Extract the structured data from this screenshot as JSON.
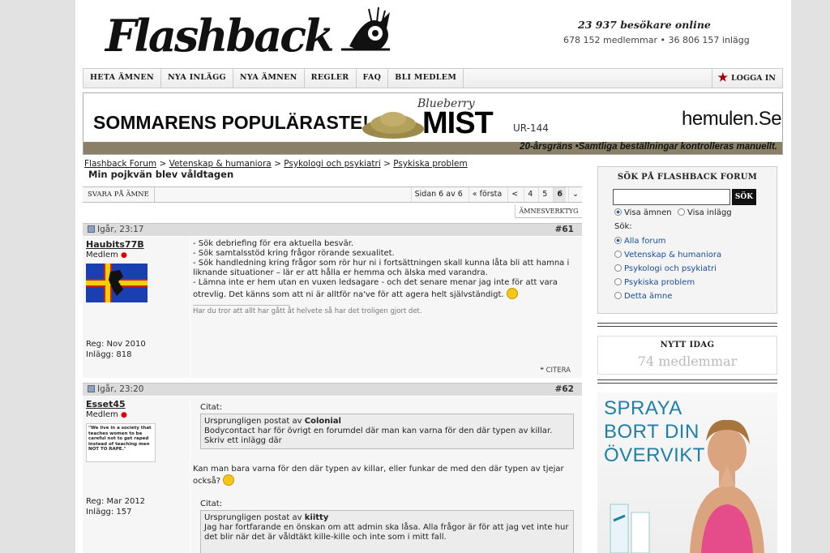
{
  "header": {
    "logo_text": "Flashback",
    "visitors": "23 937 besökare online",
    "stats": "678 152 medlemmar • 36 806 157 inlägg"
  },
  "nav": {
    "items": [
      "HETA ÄMNEN",
      "NYA INLÄGG",
      "NYA ÄMNEN",
      "REGLER",
      "FAQ",
      "BLI MEDLEM"
    ],
    "login": "LOGGA IN"
  },
  "banner": {
    "headline": "SOMMARENS POPULÄRASTE!",
    "brand_script": "Blueberry",
    "product": "MIST",
    "code": "UR-144",
    "site": "hemulen.Se",
    "footer": "20-årsgräns •Samtliga beställningar kontrolleras manuellt."
  },
  "breadcrumb": {
    "items": [
      "Flashback Forum",
      "Vetenskap & humaniora",
      "Psykologi och psykiatri",
      "Psykiska problem"
    ],
    "separator": ">",
    "thread_title": "Min pojkvän blev våldtagen"
  },
  "toolbar": {
    "reply": "SVARA PÅ ÄMNE",
    "page_info": "Sidan 6 av 6",
    "first": "« första",
    "prev": "<",
    "pages": [
      "4",
      "5",
      "6"
    ],
    "current": "6",
    "menu": "⌄",
    "tools": "ÄMNESVERKTYG"
  },
  "posts": [
    {
      "date": "Igår, 23:17",
      "num": "#61",
      "user": "Haubits77B",
      "rank": "Medlem",
      "reg": "Reg: Nov 2010",
      "posts": "Inlägg: 818",
      "lines": [
        "- Sök debriefing för era aktuella besvär.",
        "- Sök samtalsstöd kring frågor rörande sexualitet.",
        "- Sök handledning kring frågor som rör hur ni i fortsättningen skall kunna låta bli att hamna i liknande situationer – lär er att hålla er hemma och älska med varandra.",
        "- Lämna inte er hem utan en vuxen ledsagare - och det senare menar jag inte för att vara otrevlig. Det känns som att ni är alltför na've för att agera helt självständigt."
      ],
      "signature": "Har du tror att allt har gått åt helvete så har det troligen gjort det.",
      "cite": "CITERA"
    },
    {
      "date": "Igår, 23:20",
      "num": "#62",
      "user": "Esset45",
      "rank": "Medlem",
      "avatar_text": "\"We live in a society that teaches women to be careful not to get raped instead of teaching men NOT TO RAPE.\"",
      "reg": "Reg: Mar 2012",
      "posts": "Inlägg: 157",
      "quote_label": "Citat:",
      "quote1_by_prefix": "Ursprungligen postat av ",
      "quote1_by": "Colonial",
      "quote1_text": "Bodycontact har för övrigt en forumdel där man kan varna för den där typen av killar. Skriv ett inlägg där",
      "text": "Kan man bara varna för den där typen av killar, eller funkar de med den där typen av tjejar också?",
      "quote2_by_prefix": "Ursprungligen postat av ",
      "quote2_by": "kiitty",
      "quote2_text": "Jag har fortfarande en önskan om att admin ska låsa. Alla frågor är för att jag vet inte hur det blir när det är våldtäkt kille-kille och inte som i mitt fall."
    }
  ],
  "sidebar": {
    "search_title": "SÖK PÅ FLASHBACK FORUM",
    "search_value": "",
    "search_button": "SÖK",
    "show_topics": "Visa ämnen",
    "show_posts": "Visa inlägg",
    "search_in_label": "Sök:",
    "scopes": [
      "Alla forum",
      "Vetenskap & humaniora",
      "Psykologi och psykiatri",
      "Psykiska problem",
      "Detta ämne"
    ],
    "new_title": "NYTT IDAG",
    "new_count": "74 medlemmar",
    "ad_lines": [
      "SPRAYA",
      "BORT DIN",
      "ÖVERVIKT"
    ]
  },
  "colors": {
    "star": "#a30000",
    "ad_text": "#1e7fa8",
    "link": "#1a4d99"
  }
}
